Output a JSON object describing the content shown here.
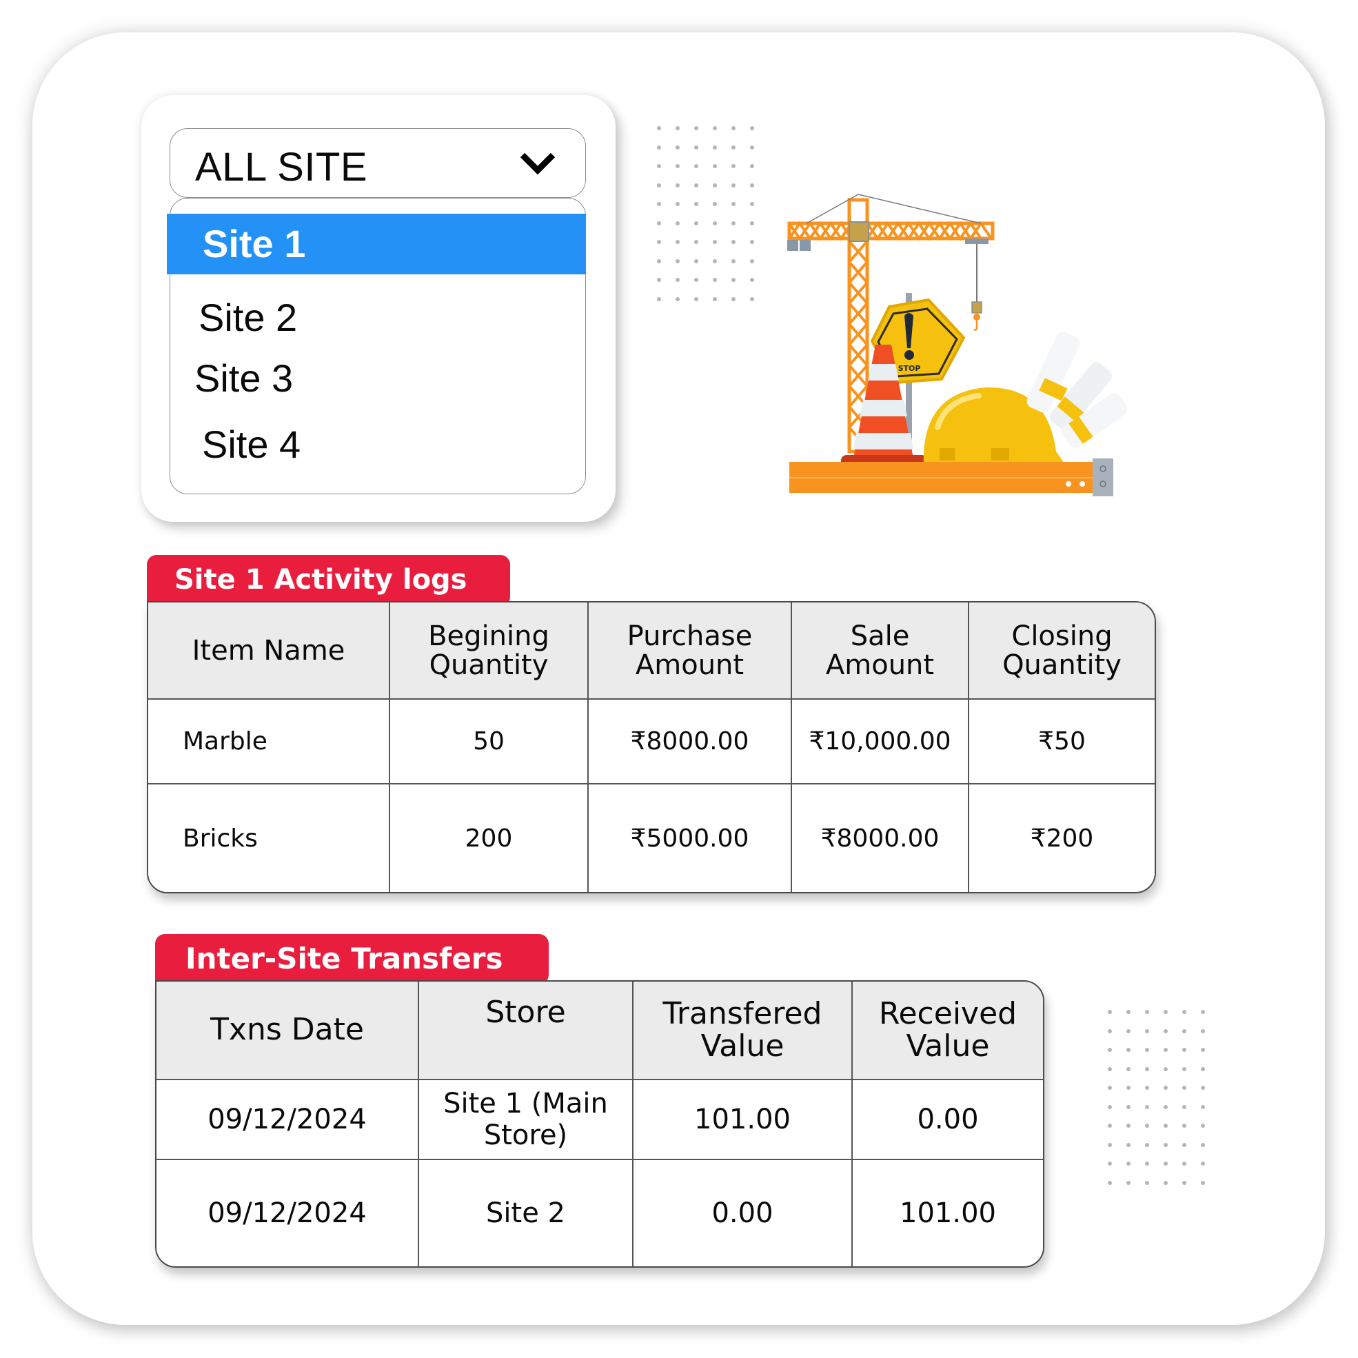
{
  "site_selector": {
    "selected_label": "ALL SITE",
    "chevron_icon": "chevron-down-icon",
    "options": [
      "Site 1",
      "Site 2",
      "Site 3",
      "Site 4"
    ],
    "highlighted_option": "Site 1",
    "highlight_color": "#2391F6"
  },
  "illustration": {
    "sign_text": "STOP",
    "description": "construction crane, warning sign, traffic cone, hard hat, blueprint rolls, measuring ruler"
  },
  "activity_logs": {
    "title": "Site 1 Activity logs",
    "accent_color": "#E91E3F",
    "columns": [
      "Item Name",
      "Begining Quantity",
      "Purchase Amount",
      "Sale Amount",
      "Closing Quantity"
    ],
    "rows": [
      {
        "item_name": "Marble",
        "begining_quantity": "50",
        "purchase_amount": "₹8000.00",
        "sale_amount": "₹10,000.00",
        "closing_quantity": "₹50"
      },
      {
        "item_name": "Bricks",
        "begining_quantity": "200",
        "purchase_amount": "₹5000.00",
        "sale_amount": "₹8000.00",
        "closing_quantity": "₹200"
      }
    ]
  },
  "transfers": {
    "title": "Inter-Site Transfers",
    "accent_color": "#E91E3F",
    "columns": [
      "Txns Date",
      "Store",
      "Transfered Value",
      "Received Value"
    ],
    "rows": [
      {
        "txns_date": "09/12/2024",
        "store": "Site 1 (Main Store)",
        "transfered_value": "101.00",
        "received_value": "0.00"
      },
      {
        "txns_date": "09/12/2024",
        "store": "Site 2",
        "transfered_value": "0.00",
        "received_value": "101.00"
      }
    ]
  }
}
